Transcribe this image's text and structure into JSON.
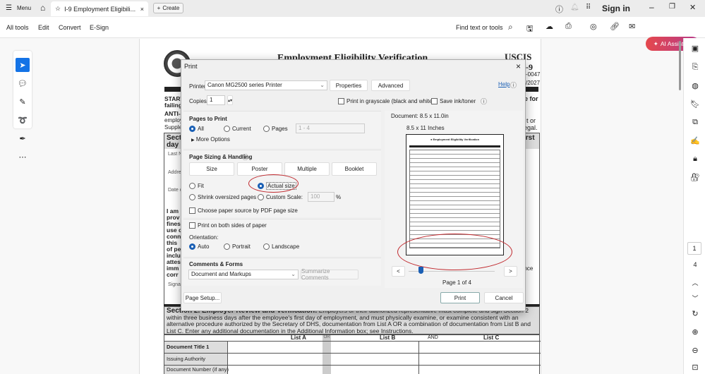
{
  "titlebar": {
    "menu": "Menu",
    "tab_title": "I-9 Employment Eligibili...",
    "create": "Create",
    "sign_in": "Sign in"
  },
  "toolbar": {
    "all_tools": "All tools",
    "edit": "Edit",
    "convert": "Convert",
    "esign": "E-Sign",
    "find": "Find text or tools",
    "ai_assistant": "AI Assistant"
  },
  "document": {
    "title": "Employment Eligibility Verification",
    "agency": "USCIS",
    "form": "-9",
    "omb": "-0047",
    "exp": "/2027",
    "frag_start": "START",
    "frag_failing": "failing",
    "frag_anti": "ANTI-I",
    "frag_employ": "employ",
    "frag_supple": "Supple",
    "frag_for": "e for",
    "frag_or": "t or",
    "frag_legal": "legal.",
    "frag_first": "irst",
    "frag_secti": "Secti",
    "frag_day": "day c",
    "frag_last": "Last N",
    "frag_addr": "Addre",
    "frag_date": "Date c",
    "frag_attest": [
      "I am",
      "prov",
      "fines",
      "use c",
      "conn",
      "this",
      "of pe",
      "inclu",
      "attes",
      "imm",
      "corr"
    ],
    "frag_ance": "ance",
    "frag_signa": "Signa",
    "section2_title": "Section 2. Employer Review and Verification:",
    "section2_text": "Employers or their authorized representative must complete and sign Section 2 within three business days after the employee's first day of employment, and must physically examine, or examine consistent with an alternative procedure authorized by the Secretary of DHS, documentation from List A OR a combination of documentation from List B and List C.  Enter any additional documentation in the Additional Information box; see Instructions.",
    "list_a": "List A",
    "or": "OR",
    "list_b": "List B",
    "and": "AND",
    "list_c": "List C",
    "rows": [
      "Document Title 1",
      "Issuing Authority",
      "Document Number (if any)"
    ]
  },
  "right_panel": {
    "current_page": "1",
    "total_pages": "4"
  },
  "print_dialog": {
    "title": "Print",
    "printer_label": "Printer:",
    "printer_value": "Canon MG2500 series Printer",
    "properties": "Properties",
    "advanced": "Advanced",
    "help": "Help",
    "copies_label": "Copies:",
    "copies_value": "1",
    "grayscale": "Print in grayscale (black and white)",
    "grayscale_checked": false,
    "save_ink": "Save ink/toner",
    "save_ink_checked": false,
    "pages_to_print": "Pages to Print",
    "all": "All",
    "current": "Current",
    "pages": "Pages",
    "pages_range": "1 - 4",
    "pages_selected": "All",
    "more_options": "More Options",
    "sizing_title": "Page Sizing & Handling",
    "sizing_tabs": [
      "Size",
      "Poster",
      "Multiple",
      "Booklet"
    ],
    "fit": "Fit",
    "actual_size": "Actual size",
    "shrink": "Shrink oversized pages",
    "custom_scale": "Custom Scale:",
    "scale_value": "100",
    "percent": "%",
    "sizing_selected": "Actual size",
    "paper_source": "Choose paper source by PDF page size",
    "both_sides": "Print on both sides of paper",
    "orientation_label": "Orientation:",
    "auto": "Auto",
    "portrait": "Portrait",
    "landscape": "Landscape",
    "orientation_selected": "Auto",
    "comments_title": "Comments & Forms",
    "comments_value": "Document and Markups",
    "summarize": "Summarize Comments",
    "doc_size": "Document: 8.5 x 11.0in",
    "paper_size": "8.5 x 11 Inches",
    "prev": "<",
    "next": ">",
    "page_indicator": "Page 1 of 4",
    "page_setup": "Page Setup...",
    "print": "Print",
    "cancel": "Cancel"
  },
  "colors": {
    "accent": "#1a5fb4",
    "annotation": "#c0282d",
    "ai_gradient_start": "#e5484d",
    "ai_gradient_end": "#b53a8a"
  }
}
